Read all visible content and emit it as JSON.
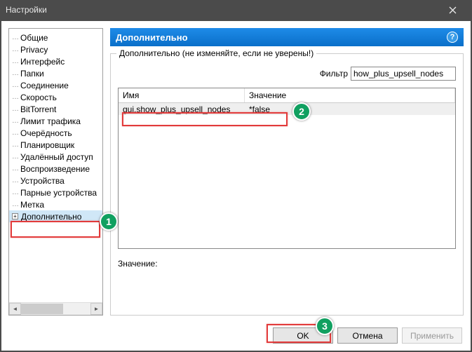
{
  "window": {
    "title": "Настройки"
  },
  "sidebar": {
    "items": [
      {
        "label": "Общие"
      },
      {
        "label": "Privacy"
      },
      {
        "label": "Интерфейс"
      },
      {
        "label": "Папки"
      },
      {
        "label": "Соединение"
      },
      {
        "label": "Скорость"
      },
      {
        "label": "BitTorrent"
      },
      {
        "label": "Лимит трафика"
      },
      {
        "label": "Очерёдность"
      },
      {
        "label": "Планировщик"
      },
      {
        "label": "Удалённый доступ"
      },
      {
        "label": "Воспроизведение"
      },
      {
        "label": "Устройства"
      },
      {
        "label": "Парные устройства"
      },
      {
        "label": "Метка"
      },
      {
        "label": "Дополнительно",
        "expandable": true,
        "selected": true
      }
    ]
  },
  "main": {
    "header": "Дополнительно",
    "group_title": "Дополнительно (не изменяйте, если не уверены!)",
    "filter_label": "Фильтр",
    "filter_value": "how_plus_upsell_nodes",
    "columns": {
      "name": "Имя",
      "value": "Значение"
    },
    "rows": [
      {
        "name": "gui.show_plus_upsell_nodes",
        "value": "*false"
      }
    ],
    "value_label": "Значение:"
  },
  "buttons": {
    "ok": "OK",
    "cancel": "Отмена",
    "apply": "Применить"
  },
  "annotations": {
    "b1": "1",
    "b2": "2",
    "b3": "3"
  }
}
